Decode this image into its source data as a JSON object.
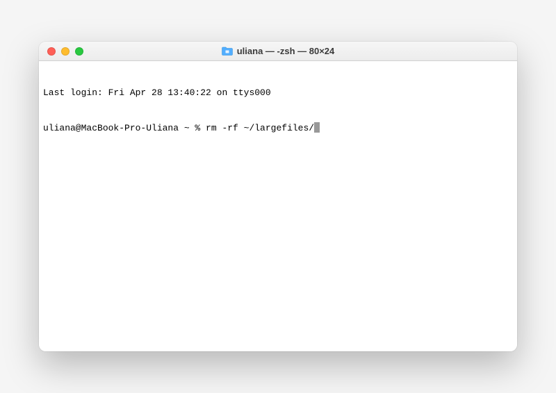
{
  "window": {
    "title": "uliana — -zsh — 80×24"
  },
  "terminal": {
    "last_login": "Last login: Fri Apr 28 13:40:22 on ttys000",
    "prompt": "uliana@MacBook-Pro-Uliana ~ % ",
    "command": "rm -rf ~/largefiles/"
  }
}
